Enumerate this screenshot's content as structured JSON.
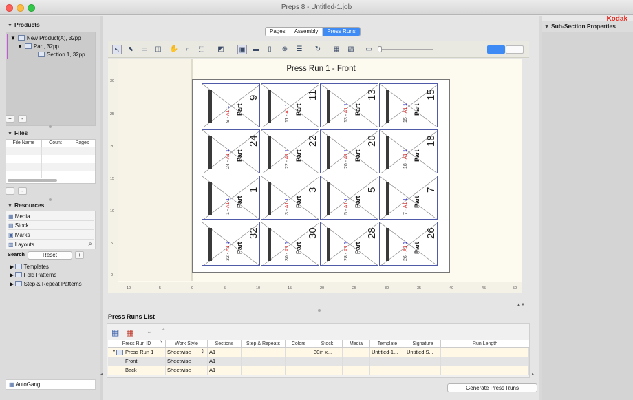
{
  "window": {
    "title": "Preps 8 - Untitled-1.job",
    "brand": "Kodak"
  },
  "products": {
    "heading": "Products",
    "tree": [
      "New Product(A), 32pp",
      "Part, 32pp",
      "Section 1, 32pp"
    ],
    "add": "+",
    "remove": "-"
  },
  "files": {
    "heading": "Files",
    "columns": [
      "File Name",
      "Count",
      "Pages"
    ],
    "add": "+",
    "remove": "-"
  },
  "resources": {
    "heading": "Resources",
    "items": [
      "Media",
      "Stock",
      "Marks",
      "Layouts"
    ],
    "search_label": "Search",
    "reset_label": "Reset",
    "add": "+",
    "tree": [
      "Templates",
      "Fold Patterns",
      "Step & Repeat Patterns"
    ]
  },
  "autogang": "AutoGang",
  "tabs": [
    "Pages",
    "Assembly",
    "Press Runs"
  ],
  "active_tab": "Press Runs",
  "canvas": {
    "title": "Press Run 1 - Front",
    "ruler_x": [
      "10",
      "5",
      "0",
      "5",
      "10",
      "15",
      "20",
      "25",
      "30",
      "35",
      "40",
      "45",
      "50"
    ],
    "ruler_y": [
      "30",
      "25",
      "20",
      "15",
      "10",
      "5",
      "0"
    ],
    "tiles": [
      {
        "num": "9",
        "label": [
          "9 - ",
          "A1",
          " 1"
        ]
      },
      {
        "num": "11",
        "label": [
          "11 - ",
          "A1",
          " 1"
        ]
      },
      {
        "num": "13",
        "label": [
          "13 - ",
          "A1",
          " 1"
        ]
      },
      {
        "num": "15",
        "label": [
          "15 - ",
          "A1",
          " 1"
        ]
      },
      {
        "num": "24",
        "label": [
          "24 - ",
          "A1",
          " 1"
        ]
      },
      {
        "num": "22",
        "label": [
          "22 - ",
          "A1",
          " 1"
        ]
      },
      {
        "num": "20",
        "label": [
          "20 - ",
          "A1",
          " 1"
        ]
      },
      {
        "num": "18",
        "label": [
          "18 - ",
          "A1",
          " 1"
        ]
      },
      {
        "num": "1",
        "label": [
          "1 - ",
          "A1",
          " 1"
        ]
      },
      {
        "num": "3",
        "label": [
          "3 - ",
          "A1",
          " 1"
        ]
      },
      {
        "num": "5",
        "label": [
          "5 - ",
          "A1",
          " 1"
        ]
      },
      {
        "num": "7",
        "label": [
          "7 - ",
          "A1",
          " 1"
        ]
      },
      {
        "num": "32",
        "label": [
          "32 - ",
          "A1",
          " 1"
        ]
      },
      {
        "num": "30",
        "label": [
          "30 - ",
          "A1",
          " 1"
        ]
      },
      {
        "num": "28",
        "label": [
          "28 - ",
          "A1",
          " 1"
        ]
      },
      {
        "num": "26",
        "label": [
          "26 - ",
          "A1",
          " 1"
        ]
      }
    ],
    "part_label": "Part"
  },
  "press_runs_list": {
    "heading": "Press Runs List",
    "columns": [
      "Press Run ID",
      "Work Style",
      "Sections",
      "Step & Repeats",
      "Colors",
      "Stock",
      "Media",
      "Template",
      "Signature",
      "Run Length"
    ],
    "rows": [
      [
        "Press Run 1",
        "Sheetwise",
        "A1",
        "",
        "",
        "30in x...",
        "",
        "Untitled-1...",
        "Untitled S...",
        ""
      ],
      [
        "Front",
        "Sheetwise",
        "A1",
        "",
        "",
        "",
        "",
        "",
        "",
        ""
      ],
      [
        "Back",
        "Sheetwise",
        "A1",
        "",
        "",
        "",
        "",
        "",
        "",
        ""
      ]
    ],
    "generate_label": "Generate Press Runs"
  },
  "subsection": {
    "heading": "Sub-Section Properties"
  },
  "icons": [
    "arrow-select-icon",
    "pointer-icon",
    "page-select-icon",
    "page-add-icon",
    "hand-icon",
    "zoom-icon",
    "marquee-icon",
    "color-picker-icon",
    "view-icon",
    "ruler-icon",
    "page-icon",
    "crosshair-icon",
    "distribute-icon",
    "rotate-icon",
    "layout-icon",
    "layout-alt-icon",
    "screen-icon"
  ]
}
